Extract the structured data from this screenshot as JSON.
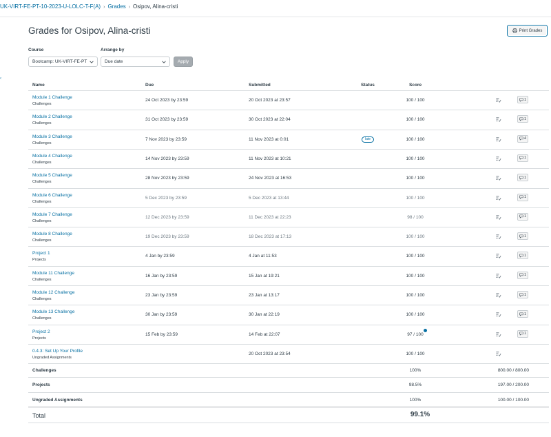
{
  "breadcrumb": {
    "course": "UK-VIRT-FE-PT-10-2023-U-LOLC-T-F(A)",
    "section": "Grades",
    "current": "Osipov, Alina-cristi"
  },
  "page": {
    "title": "Grades for Osipov, Alina-cristi",
    "print_label": "Print Grades"
  },
  "filters": {
    "course_label": "Course",
    "course_value": "Bootcamp: UK-VIRT-FE-PT",
    "arrange_label": "Arrange by",
    "arrange_value": "Due date",
    "apply_label": "Apply"
  },
  "table": {
    "headers": {
      "name": "Name",
      "due": "Due",
      "submitted": "Submitted",
      "status": "Status",
      "score": "Score"
    },
    "rows": [
      {
        "name": "Module 1 Challenge",
        "group": "Challenges",
        "due": "24 Oct 2023 by 23:59",
        "submitted": "20 Oct 2023 at 23:57",
        "status": "",
        "score": "100 / 100",
        "comments": "1"
      },
      {
        "name": "Module 2 Challenge",
        "group": "Challenges",
        "due": "31 Oct 2023 by 23:59",
        "submitted": "30 Oct 2023 at 22:04",
        "status": "",
        "score": "100 / 100",
        "comments": "1"
      },
      {
        "name": "Module 3 Challenge",
        "group": "Challenges",
        "due": "7 Nov 2023 by 23:59",
        "submitted": "11 Nov 2023 at 0:01",
        "status": "late",
        "score": "100 / 100",
        "comments": "4"
      },
      {
        "name": "Module 4 Challenge",
        "group": "Challenges",
        "due": "14 Nov 2023 by 23:59",
        "submitted": "11 Nov 2023 at 10:21",
        "status": "",
        "score": "100 / 100",
        "comments": "1"
      },
      {
        "name": "Module 5 Challenge",
        "group": "Challenges",
        "due": "28 Nov 2023 by 23:59",
        "submitted": "24 Nov 2023 at 16:53",
        "status": "",
        "score": "100 / 100",
        "comments": "1"
      },
      {
        "name": "Module 6 Challenge",
        "group": "Challenges",
        "due": "5 Dec 2023 by 23:59",
        "submitted": "5 Dec 2023 at 13:44",
        "status": "",
        "score": "100 / 100",
        "comments": "1"
      },
      {
        "name": "Module 7 Challenge",
        "group": "Challenges",
        "due": "12 Dec 2023 by 23:59",
        "submitted": "11 Dec 2023 at 22:23",
        "status": "",
        "score": "98 / 100",
        "comments": "1"
      },
      {
        "name": "Module 8 Challenge",
        "group": "Challenges",
        "due": "19 Dec 2023 by 23:59",
        "submitted": "18 Dec 2023 at 17:13",
        "status": "",
        "score": "100 / 100",
        "comments": "1"
      },
      {
        "name": "Project 1",
        "group": "Projects",
        "due": "4 Jan by 23:59",
        "submitted": "4 Jan at 11:53",
        "status": "",
        "score": "100 / 100",
        "comments": "1"
      },
      {
        "name": "Module 11 Challenge",
        "group": "Challenges",
        "due": "16 Jan by 23:59",
        "submitted": "15 Jan at 19:21",
        "status": "",
        "score": "100 / 100",
        "comments": "1"
      },
      {
        "name": "Module 12 Challenge",
        "group": "Challenges",
        "due": "23 Jan by 23:59",
        "submitted": "23 Jan at 13:17",
        "status": "",
        "score": "100 / 100",
        "comments": "1"
      },
      {
        "name": "Module 13 Challenge",
        "group": "Challenges",
        "due": "30 Jan by 23:59",
        "submitted": "30 Jan at 22:19",
        "status": "",
        "score": "100 / 100",
        "comments": "1"
      },
      {
        "name": "Project 2",
        "group": "Projects",
        "due": "15 Feb by 23:59",
        "submitted": "14 Feb at 22:07",
        "status": "",
        "score": "97 / 100",
        "comments": "1"
      },
      {
        "name": "0.4.3: Set Up Your Profile",
        "group": "Ungraded Assignments",
        "due": "",
        "submitted": "20 Oct 2023 at 23:54",
        "status": "",
        "score": "100 / 100",
        "comments": ""
      }
    ]
  },
  "summary": [
    {
      "label": "Challenges",
      "percent": "100%",
      "points": "800.00 / 800.00"
    },
    {
      "label": "Projects",
      "percent": "98.5%",
      "points": "197.00 / 200.00"
    },
    {
      "label": "Ungraded Assignments",
      "percent": "100%",
      "points": "100.00 / 100.00"
    }
  ],
  "total": {
    "label": "Total",
    "percent": "99.1%"
  },
  "colors": {
    "link": "#0770a3",
    "text": "#2d3b45",
    "border": "#d9dde0"
  },
  "icons": {
    "print": "printer-icon",
    "rubric": "rubric-icon",
    "comments": "comment-icon",
    "chevron": "chevron-down-icon"
  }
}
